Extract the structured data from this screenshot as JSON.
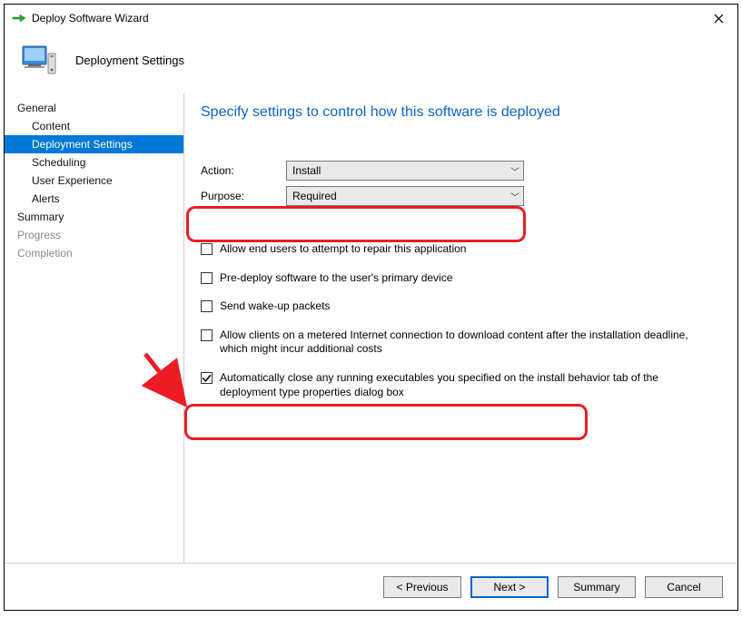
{
  "window": {
    "title": "Deploy Software Wizard"
  },
  "header": {
    "subtitle": "Deployment Settings"
  },
  "sidebar": {
    "items": [
      {
        "label": "General",
        "level": 0,
        "active": false,
        "disabled": false
      },
      {
        "label": "Content",
        "level": 1,
        "active": false,
        "disabled": false
      },
      {
        "label": "Deployment Settings",
        "level": 1,
        "active": true,
        "disabled": false
      },
      {
        "label": "Scheduling",
        "level": 1,
        "active": false,
        "disabled": false
      },
      {
        "label": "User Experience",
        "level": 1,
        "active": false,
        "disabled": false
      },
      {
        "label": "Alerts",
        "level": 1,
        "active": false,
        "disabled": false
      },
      {
        "label": "Summary",
        "level": 0,
        "active": false,
        "disabled": false
      },
      {
        "label": "Progress",
        "level": 0,
        "active": false,
        "disabled": true
      },
      {
        "label": "Completion",
        "level": 0,
        "active": false,
        "disabled": true
      }
    ]
  },
  "main": {
    "heading": "Specify settings to control how this software is deployed",
    "action_label": "Action:",
    "action_value": "Install",
    "purpose_label": "Purpose:",
    "purpose_value": "Required",
    "checks": [
      {
        "label": "Allow end users to attempt to repair this application",
        "checked": false
      },
      {
        "label": "Pre-deploy software to the user's primary device",
        "checked": false
      },
      {
        "label": "Send wake-up packets",
        "checked": false
      },
      {
        "label": "Allow clients on a metered Internet connection to download content after the installation deadline, which might incur additional costs",
        "checked": false
      },
      {
        "label": "Automatically close any running executables you specified on the install behavior tab of the deployment type properties dialog box",
        "checked": true
      }
    ]
  },
  "footer": {
    "previous": "< Previous",
    "next": "Next >",
    "summary": "Summary",
    "cancel": "Cancel"
  }
}
